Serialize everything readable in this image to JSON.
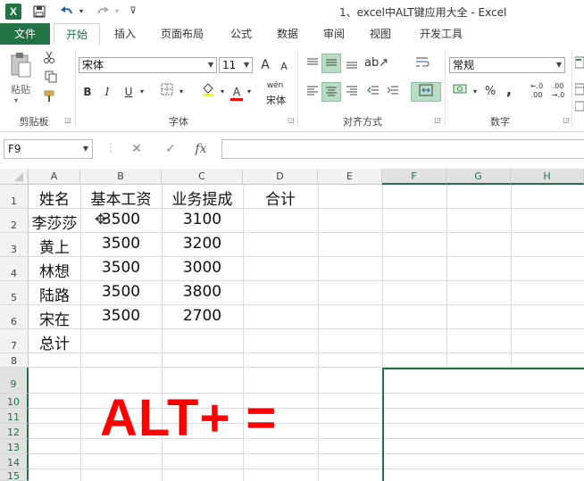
{
  "window": {
    "title": "1、excel中ALT键应用大全 - Excel",
    "logo": "X",
    "qat": [
      "save-icon",
      "undo-icon",
      "redo-icon",
      "customize-icon"
    ]
  },
  "ribbon": {
    "tabs": [
      "文件",
      "开始",
      "插入",
      "页面布局",
      "公式",
      "数据",
      "审阅",
      "视图",
      "开发工具"
    ],
    "active_tab": "开始",
    "groups": {
      "clipboard": {
        "label": "剪贴板",
        "paste": "粘贴"
      },
      "font": {
        "label": "字体",
        "font_name": "宋体",
        "font_size": "11",
        "bold": "B",
        "italic": "I",
        "underline": "U",
        "grow": "A",
        "shrink": "A",
        "color_a": "A",
        "phonetic": "wén"
      },
      "alignment": {
        "label": "对齐方式"
      },
      "number": {
        "label": "数字",
        "format": "常规",
        "percent": "%",
        "comma": ","
      }
    }
  },
  "formula_bar": {
    "name_box": "F9",
    "fx": "fx",
    "value": ""
  },
  "columns": [
    "A",
    "B",
    "C",
    "D",
    "E",
    "F",
    "G",
    "H"
  ],
  "active_column": "F",
  "rows": [
    "1",
    "2",
    "3",
    "4",
    "5",
    "6",
    "7",
    "8",
    "9",
    "10",
    "11",
    "12",
    "13",
    "14",
    "15"
  ],
  "active_row": "9",
  "table": {
    "headers": [
      "姓名",
      "基本工资",
      "业务提成",
      "合计"
    ],
    "rows": [
      [
        "李莎莎",
        "3500",
        "3100"
      ],
      [
        "黄上",
        "3500",
        "3200"
      ],
      [
        "林想",
        "3500",
        "3000"
      ],
      [
        "陆路",
        "3500",
        "3800"
      ],
      [
        "宋在",
        "3500",
        "2700"
      ]
    ],
    "total_label": "总计"
  },
  "overlay_text": "ALT+ =",
  "colors": {
    "excel_green": "#217346",
    "overlay_red": "#ff0000"
  }
}
